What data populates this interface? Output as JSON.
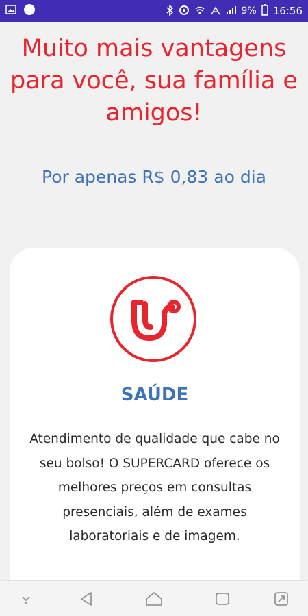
{
  "status_bar": {
    "time": "16:56",
    "battery": "9%",
    "left_icons": [
      "image-icon",
      "circle-notification-icon"
    ],
    "right_icons": [
      "bluetooth-icon",
      "vpn-icon",
      "wifi-icon",
      "signal-icon",
      "battery-icon"
    ]
  },
  "header": {
    "headline": "Muito mais vantagens para você, sua família e amigos!",
    "price_line": "Por apenas R$ 0,83 ao dia"
  },
  "card": {
    "icon": "stethoscope-icon",
    "title": "SAÚDE",
    "description": "Atendimento de qualidade que cabe no seu bolso! O SUPERCARD oferece os melhores preços em consultas presenciais, além de exames laboratoriais e de imagem."
  },
  "nav_bar": {
    "buttons": [
      "hide-nav-icon",
      "back-icon",
      "home-icon",
      "recents-icon",
      "screen-toggle-icon"
    ]
  },
  "colors": {
    "accent_red": "#e8252d",
    "accent_blue": "#3f72b6",
    "status_bar": "#3f2db4",
    "background": "#f1f1f1"
  }
}
